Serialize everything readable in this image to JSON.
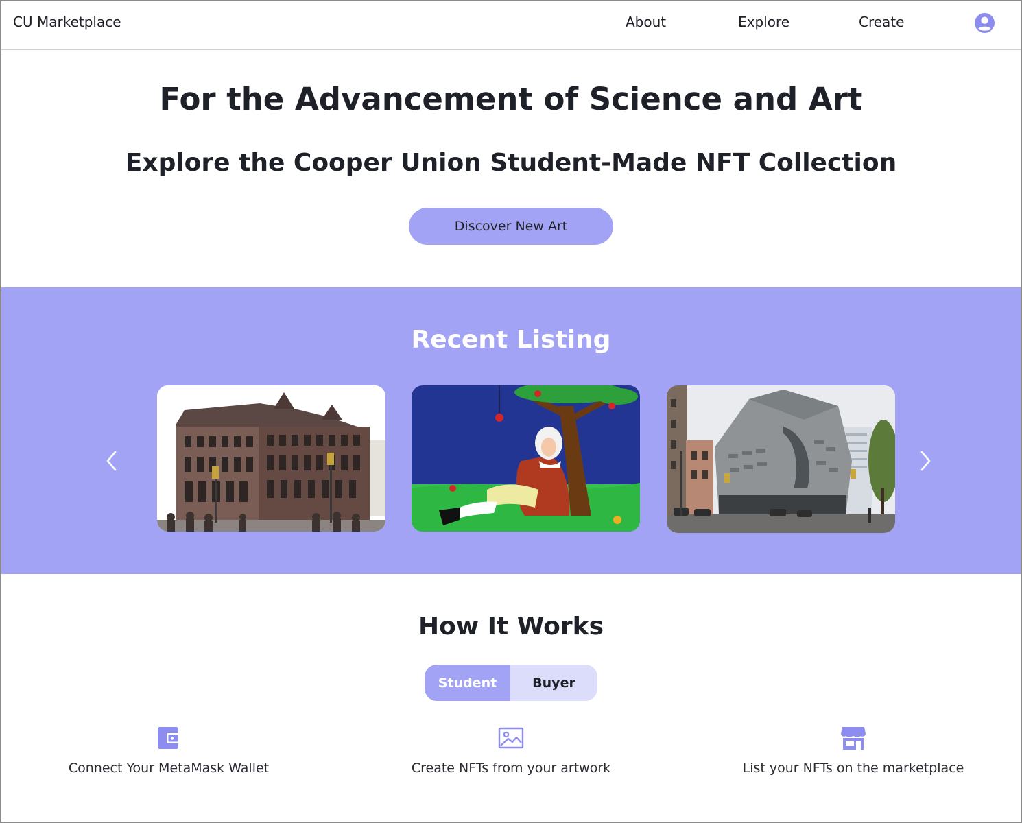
{
  "nav": {
    "brand": "CU Marketplace",
    "links": [
      "About",
      "Explore",
      "Create"
    ],
    "profile_icon": "user-circle-icon"
  },
  "hero": {
    "title": "For the Advancement of Science and Art",
    "subtitle": "Explore the Cooper Union Student-Made NFT Collection",
    "cta_label": "Discover New Art"
  },
  "listing": {
    "title": "Recent Listing",
    "prev_icon": "chevron-left-icon",
    "next_icon": "chevron-right-icon",
    "cards": [
      {
        "image": "foundation-building-photo"
      },
      {
        "image": "newton-under-apple-tree-illustration"
      },
      {
        "image": "41-cooper-square-photo"
      }
    ]
  },
  "how_it_works": {
    "title": "How It Works",
    "tabs": [
      {
        "label": "Student",
        "active": true
      },
      {
        "label": "Buyer",
        "active": false
      }
    ],
    "steps": [
      {
        "icon": "wallet-icon",
        "label": "Connect Your MetaMask Wallet"
      },
      {
        "icon": "image-icon",
        "label": "Create NFTs from your artwork"
      },
      {
        "icon": "storefront-icon",
        "label": "List your NFTs on the marketplace"
      }
    ]
  },
  "colors": {
    "accent": "#a3a3f5",
    "accent_light": "#dcdcfb",
    "icon": "#8d8df0",
    "text": "#1e2128"
  }
}
